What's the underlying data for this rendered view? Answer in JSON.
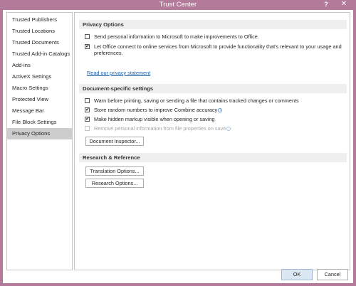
{
  "window": {
    "title": "Trust Center",
    "help_label": "?",
    "close_label": "✕"
  },
  "sidebar": {
    "items": [
      {
        "label": "Trusted Publishers"
      },
      {
        "label": "Trusted Locations"
      },
      {
        "label": "Trusted Documents"
      },
      {
        "label": "Trusted Add-in Catalogs"
      },
      {
        "label": "Add-ins"
      },
      {
        "label": "ActiveX Settings"
      },
      {
        "label": "Macro Settings"
      },
      {
        "label": "Protected View"
      },
      {
        "label": "Message Bar"
      },
      {
        "label": "File Block Settings"
      },
      {
        "label": "Privacy Options",
        "selected": true
      }
    ]
  },
  "privacy": {
    "header": "Privacy Options",
    "options": [
      {
        "label": "Send personal information to Microsoft to make improvements to Office.",
        "checked": false
      },
      {
        "label": "Let Office connect to online services from Microsoft to provide functionality that's relevant to your usage and preferences.",
        "checked": true
      }
    ],
    "link": "Read our privacy statement"
  },
  "document": {
    "header": "Document-specific settings",
    "options": [
      {
        "label": "Warn before printing, saving or sending a file that contains tracked changes or comments",
        "checked": false
      },
      {
        "label": "Store random numbers to improve Combine accuracy",
        "checked": true,
        "info": true
      },
      {
        "label": "Make hidden markup visible when opening or saving",
        "checked": true
      },
      {
        "label": "Remove personal information from file properties on save",
        "checked": false,
        "disabled": true,
        "info": true
      }
    ],
    "inspector_button": "Document Inspector..."
  },
  "research": {
    "header": "Research & Reference",
    "translation_button": "Translation Options...",
    "research_button": "Research Options..."
  },
  "footer": {
    "ok": "OK",
    "cancel": "Cancel"
  },
  "info_glyph": "i"
}
